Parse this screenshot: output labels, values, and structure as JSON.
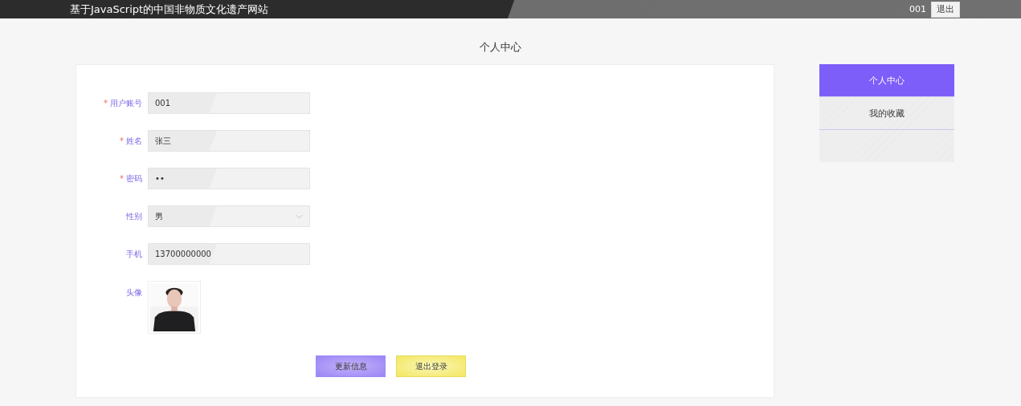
{
  "header": {
    "site_title": "基于JavaScript的中国非物质文化遗产网站",
    "user": "001",
    "logout_button": "退出"
  },
  "page_title": "个人中心",
  "form": {
    "fields": [
      {
        "kind": "text",
        "required_mark": "*",
        "label": "用户账号",
        "value": "001"
      },
      {
        "kind": "text",
        "required_mark": "*",
        "label": "姓名",
        "value": "张三"
      },
      {
        "kind": "password",
        "required_mark": "*",
        "label": "密码",
        "value": "••"
      },
      {
        "kind": "select",
        "label": "性别",
        "value": "男"
      },
      {
        "kind": "text",
        "label": "手机",
        "value": "13700000000"
      },
      {
        "label": "头像"
      }
    ],
    "buttons": [
      {
        "kind": "primary",
        "label": "更新信息"
      },
      {
        "kind": "warning",
        "label": "退出登录"
      }
    ]
  },
  "sidebar": {
    "items": [
      {
        "label": "个人中心",
        "selected": true
      },
      {
        "label": "我的收藏",
        "selected": false
      }
    ]
  }
}
